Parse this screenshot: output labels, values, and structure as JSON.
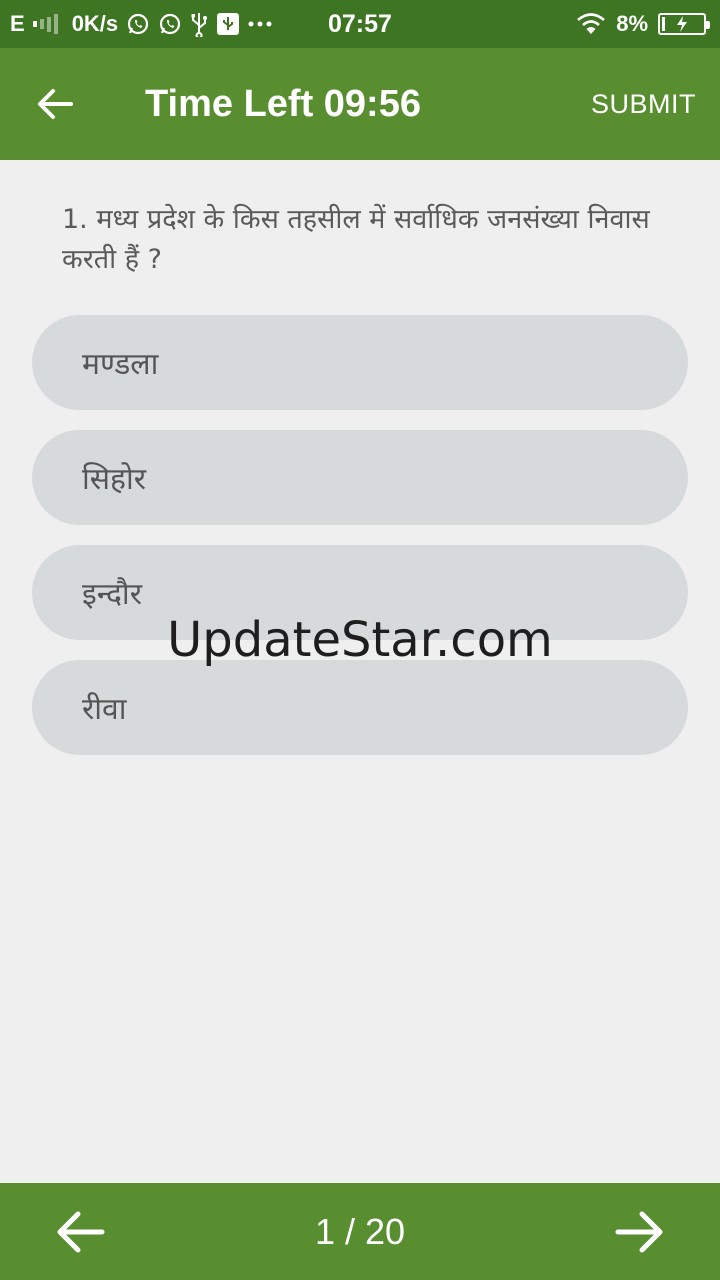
{
  "status_bar": {
    "network": "E",
    "speed": "0K/s",
    "time": "07:57",
    "battery": "8%",
    "battery_level": 0.08,
    "icons": [
      "signal-icon",
      "whatsapp-icon",
      "whatsapp-icon",
      "usb-icon",
      "usb-debug-icon",
      "more-notifications-icon",
      "wifi-icon",
      "battery-charging-icon"
    ]
  },
  "app_bar": {
    "back_icon": "arrow-left-icon",
    "title": "Time Left 09:56",
    "submit_label": "SUBMIT"
  },
  "question": {
    "text": "1. मध्य प्रदेश के किस तहसील में सर्वाधिक जनसंख्या निवास करती हैं ?"
  },
  "options": [
    {
      "label": "मण्डला"
    },
    {
      "label": "सिहोर"
    },
    {
      "label": "इन्दौर"
    },
    {
      "label": "रीवा"
    }
  ],
  "watermark": "UpdateStar.com",
  "bottom_bar": {
    "prev_icon": "arrow-left-icon",
    "page": "1 / 20",
    "next_icon": "arrow-right-icon"
  },
  "colors": {
    "status_bar": "#3d7523",
    "app_bar": "#588e30",
    "background": "#efefef",
    "option_bg": "#d6dadb"
  }
}
